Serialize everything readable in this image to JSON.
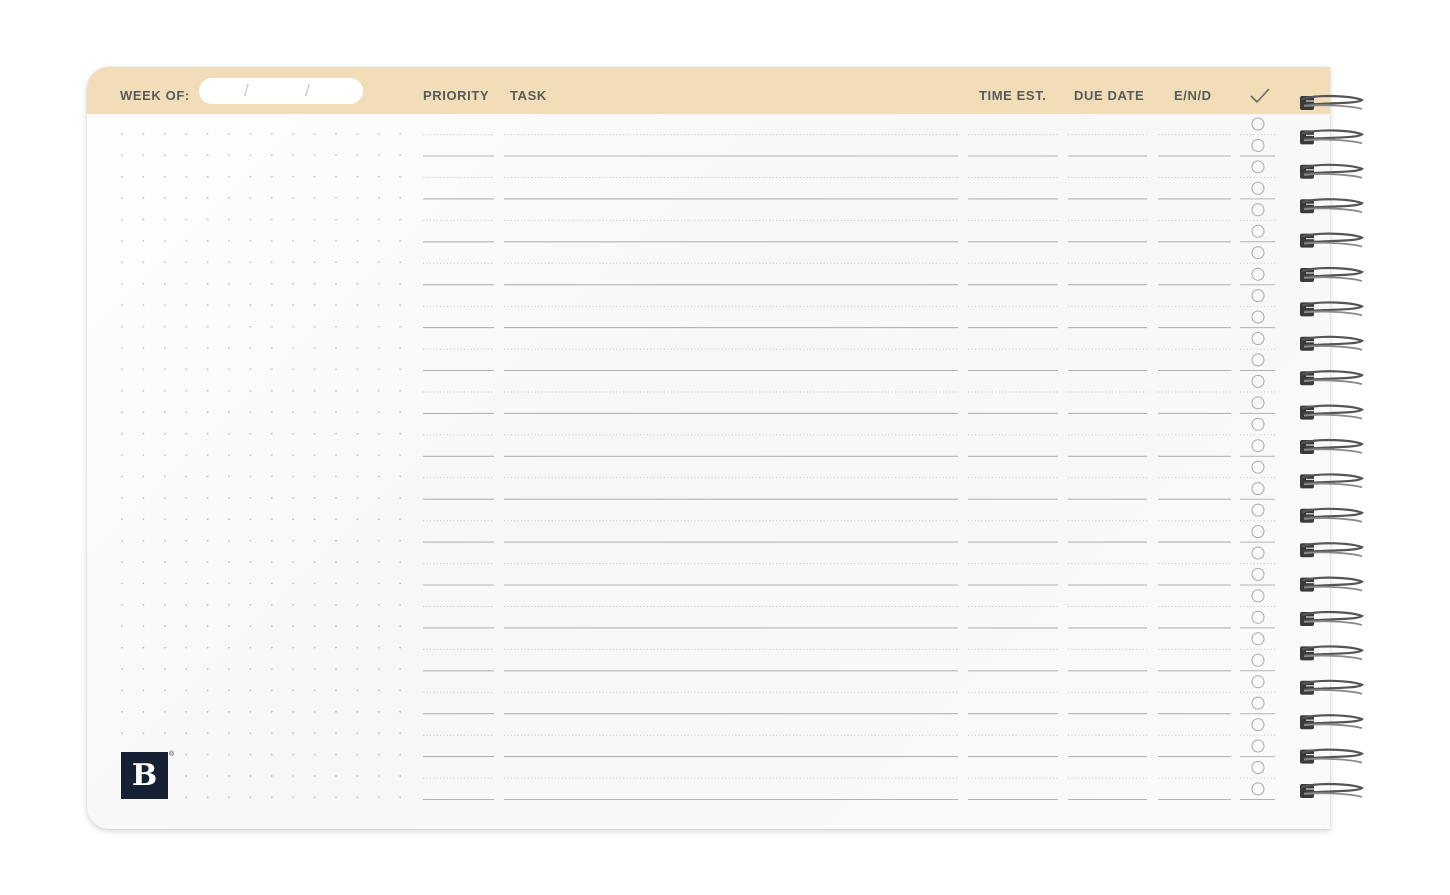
{
  "header": {
    "week_of_label": "WEEK OF:",
    "date_separator": "/",
    "columns": {
      "priority": "PRIORITY",
      "task": "TASK",
      "time_est": "TIME EST.",
      "due_date": "DUE DATE",
      "end": "E/N/D"
    },
    "done_icon": "checkmark-icon"
  },
  "logo": {
    "letter": "B",
    "mark": "®"
  },
  "colors": {
    "header": "#f1deb8",
    "logo_bg": "#152033"
  },
  "binding": {
    "icon": "spiral-coil-icon"
  }
}
